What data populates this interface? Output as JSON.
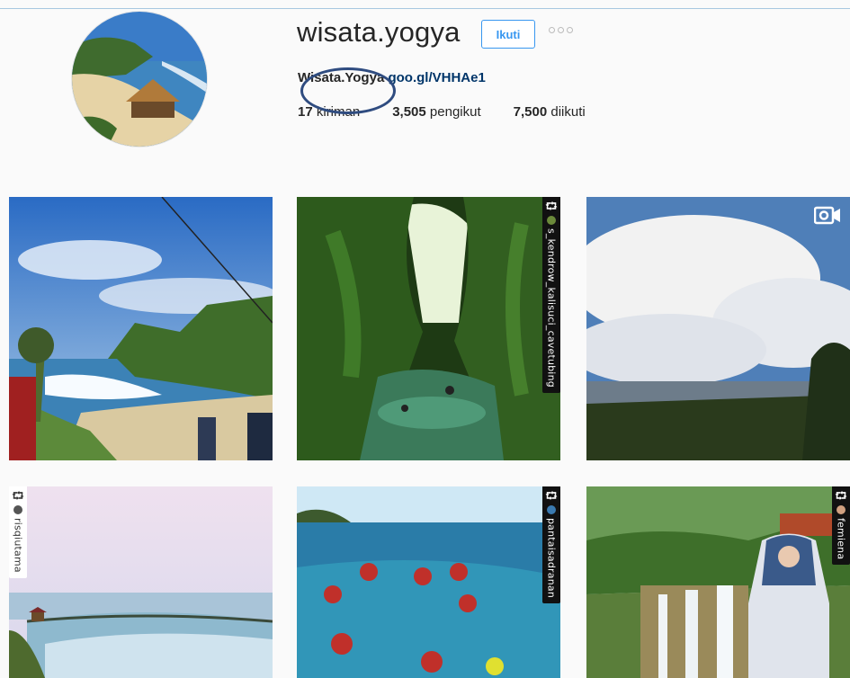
{
  "profile": {
    "username": "wisata.yogya",
    "follow_label": "Ikuti",
    "bio_name": "Wisata.Yogya",
    "bio_link": "goo.gl/VHHAe1",
    "posts_count": "17",
    "posts_label": "kiriman",
    "followers_count": "3,505",
    "followers_label": "pengikut",
    "following_count": "7,500",
    "following_label": "diikuti"
  },
  "posts": [
    {
      "type": "photo"
    },
    {
      "type": "repost",
      "user": "s_kendrow_kalisuci_cavetubing"
    },
    {
      "type": "video"
    },
    {
      "type": "repost",
      "user": "risqiutama"
    },
    {
      "type": "repost",
      "user": "pantaisadranan"
    },
    {
      "type": "repost",
      "user": "femiena"
    }
  ],
  "colors": {
    "accent": "#3897f0",
    "link": "#003569",
    "annotation": "#2f4c80"
  }
}
